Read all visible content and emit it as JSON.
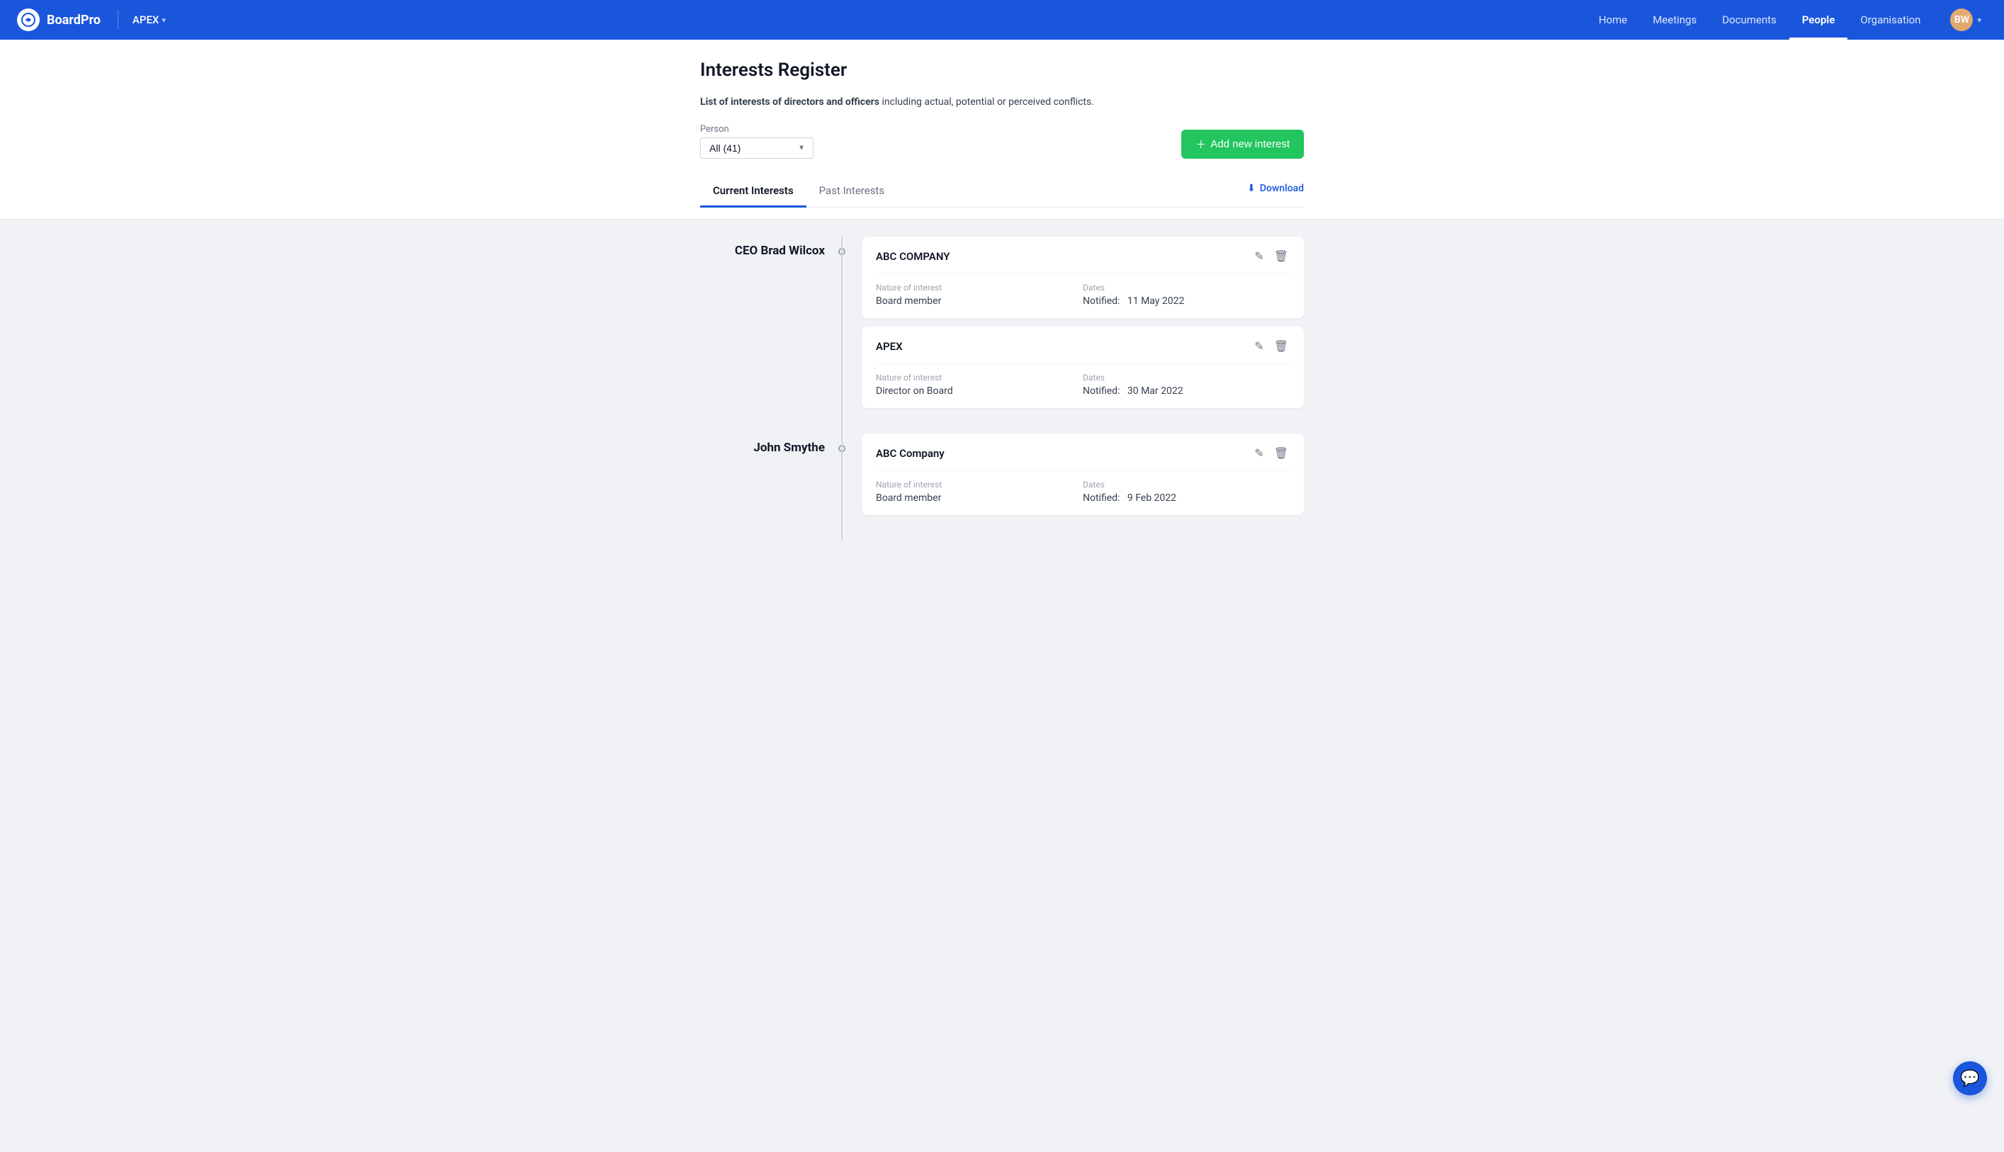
{
  "navbar": {
    "brand": "BoardPro",
    "org_name": "APEX",
    "nav_items": [
      {
        "label": "Home",
        "active": false
      },
      {
        "label": "Meetings",
        "active": false
      },
      {
        "label": "Documents",
        "active": false
      },
      {
        "label": "People",
        "active": true
      },
      {
        "label": "Organisation",
        "active": false
      }
    ],
    "avatar_initials": "BW"
  },
  "page": {
    "title": "Interests Register",
    "description_prefix": "List of interests of directors and officers",
    "description_suffix": " including actual, potential or perceived conflicts.",
    "person_label": "Person",
    "person_select_value": "All (41)",
    "add_button_label": "Add new interest"
  },
  "tabs": {
    "items": [
      {
        "label": "Current Interests",
        "active": true
      },
      {
        "label": "Past Interests",
        "active": false
      }
    ],
    "download_label": "Download"
  },
  "persons": [
    {
      "name": "CEO Brad Wilcox",
      "interests": [
        {
          "company": "ABC COMPANY",
          "nature_label": "Nature of interest",
          "nature_value": "Board member",
          "dates_label": "Dates",
          "notified_label": "Notified:",
          "notified_date": "11 May 2022"
        },
        {
          "company": "APEX",
          "nature_label": "Nature of interest",
          "nature_value": "Director on Board",
          "dates_label": "Dates",
          "notified_label": "Notified:",
          "notified_date": "30 Mar 2022"
        }
      ]
    },
    {
      "name": "John Smythe",
      "interests": [
        {
          "company": "ABC Company",
          "nature_label": "Nature of interest",
          "nature_value": "Board member",
          "dates_label": "Dates",
          "notified_label": "Notified:",
          "notified_date": "9 Feb 2022"
        }
      ]
    }
  ],
  "icons": {
    "plus": "+",
    "download": "⬇",
    "pencil": "✎",
    "trash": "🗑",
    "chat": "💬",
    "chevron_down": "▾"
  },
  "colors": {
    "primary": "#1a56db",
    "green": "#22c55e",
    "active_tab_underline": "#1a56db"
  }
}
